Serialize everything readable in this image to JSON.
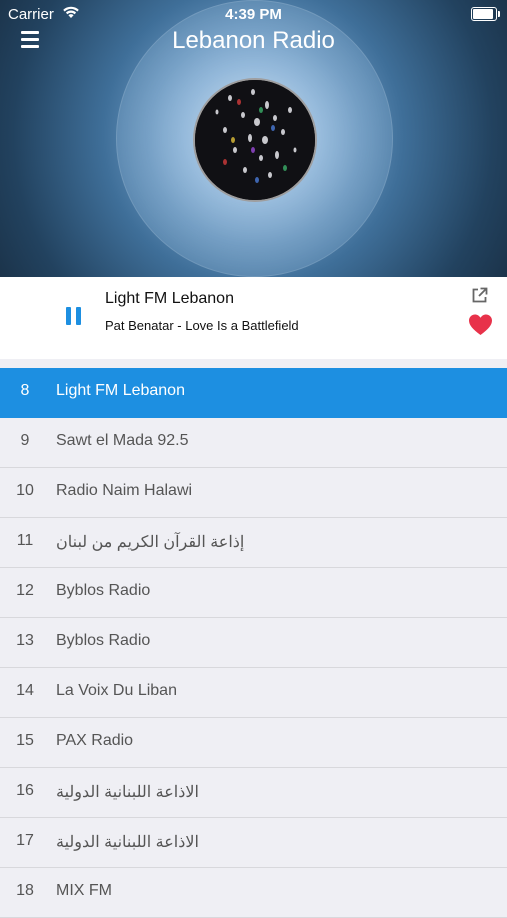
{
  "status_bar": {
    "carrier": "Carrier",
    "time": "4:39 PM"
  },
  "header": {
    "title": "Lebanon Radio",
    "menu_icon": "hamburger-menu-icon"
  },
  "now_playing": {
    "station": "Light FM Lebanon",
    "track": "Pat Benatar - Love Is a Battlefield",
    "state": "playing",
    "accent_color": "#1d8fe1",
    "favorite_color": "#e8324a"
  },
  "stations": [
    {
      "number": "8",
      "name": "Light FM Lebanon",
      "active": true
    },
    {
      "number": "9",
      "name": "Sawt el Mada 92.5"
    },
    {
      "number": "10",
      "name": "Radio Naim Halawi"
    },
    {
      "number": "11",
      "name": "إذاعة القرآن الكريم من لبنان"
    },
    {
      "number": "12",
      "name": "Byblos Radio"
    },
    {
      "number": "13",
      "name": "Byblos Radio"
    },
    {
      "number": "14",
      "name": "La Voix Du Liban"
    },
    {
      "number": "15",
      "name": "PAX Radio"
    },
    {
      "number": "16",
      "name": "الاذاعة اللبنانية الدولية"
    },
    {
      "number": "17",
      "name": "الاذاعة اللبنانية الدولية"
    },
    {
      "number": "18",
      "name": "MIX FM"
    }
  ]
}
